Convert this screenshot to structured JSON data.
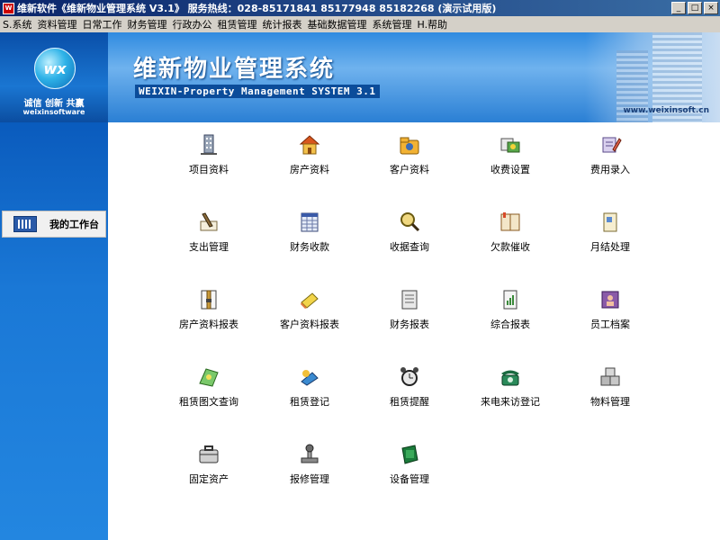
{
  "window": {
    "title": "维新软件《维新物业管理系统 V3.1》  服务热线：028-85171841 85177948 85182268 (演示试用版)",
    "buttons": [
      "_",
      "□",
      "×"
    ]
  },
  "menu": [
    {
      "label": "S.系统"
    },
    {
      "label": "资料管理"
    },
    {
      "label": "日常工作"
    },
    {
      "label": "财务管理"
    },
    {
      "label": "行政办公"
    },
    {
      "label": "租赁管理"
    },
    {
      "label": "统计报表"
    },
    {
      "label": "基础数据管理"
    },
    {
      "label": "系统管理"
    },
    {
      "label": "H.帮助"
    }
  ],
  "logo": {
    "mark": "wx",
    "slogan": "诚信 创新 共赢",
    "brand": "weixinsoftware"
  },
  "banner": {
    "title": "维新物业管理系统",
    "subtitle": "WEIXIN-Property Management SYSTEM 3.1",
    "url": "www.weixinsoft.cn"
  },
  "sidebar": {
    "item": "我的工作台"
  },
  "modules": [
    {
      "label": "项目资料",
      "icon": "building-icon"
    },
    {
      "label": "房产资料",
      "icon": "house-icon"
    },
    {
      "label": "客户资料",
      "icon": "client-folder-icon"
    },
    {
      "label": "收费设置",
      "icon": "fee-setting-icon"
    },
    {
      "label": "费用录入",
      "icon": "fee-entry-icon"
    },
    {
      "label": "支出管理",
      "icon": "expense-pen-icon"
    },
    {
      "label": "财务收款",
      "icon": "ledger-icon"
    },
    {
      "label": "收据查询",
      "icon": "magnifier-icon"
    },
    {
      "label": "欠款催收",
      "icon": "book-icon"
    },
    {
      "label": "月结处理",
      "icon": "monthly-doc-icon"
    },
    {
      "label": "房产资料报表",
      "icon": "zip-file-icon"
    },
    {
      "label": "客户资料报表",
      "icon": "eraser-icon"
    },
    {
      "label": "财务报表",
      "icon": "newspaper-icon"
    },
    {
      "label": "综合报表",
      "icon": "report-doc-icon"
    },
    {
      "label": "员工档案",
      "icon": "employee-file-icon"
    },
    {
      "label": "租赁图文查询",
      "icon": "map-icon"
    },
    {
      "label": "租赁登记",
      "icon": "register-icon"
    },
    {
      "label": "租赁提醒",
      "icon": "alarm-clock-icon"
    },
    {
      "label": "来电来访登记",
      "icon": "telephone-icon"
    },
    {
      "label": "物料管理",
      "icon": "boxes-icon"
    },
    {
      "label": "固定资产",
      "icon": "briefcase-icon"
    },
    {
      "label": "报修管理",
      "icon": "repair-tool-icon"
    },
    {
      "label": "设备管理",
      "icon": "device-icon"
    }
  ]
}
